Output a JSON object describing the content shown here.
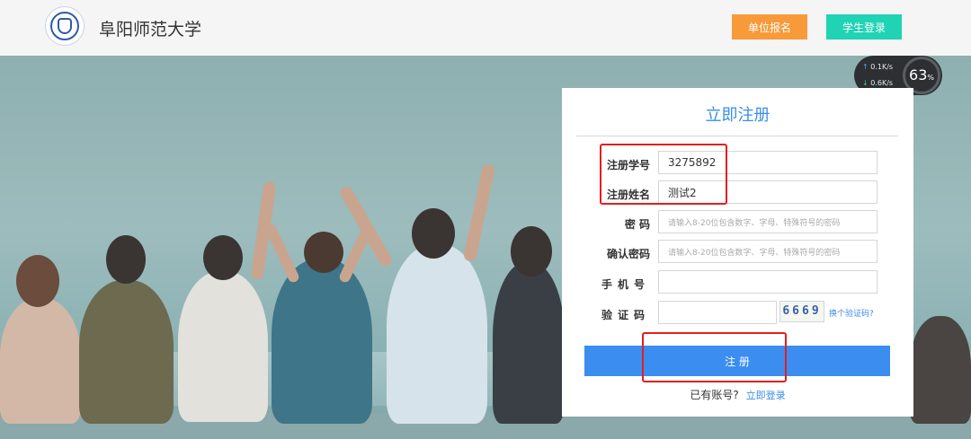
{
  "header": {
    "school_name": "阜阳师范大学",
    "unit_signup_label": "单位报名",
    "student_login_label": "学生登录"
  },
  "speed_widget": {
    "upload": "0.1",
    "upload_unit": "K/s",
    "download": "0.6",
    "download_unit": "K/s",
    "percent": "63",
    "percent_unit": "%"
  },
  "form": {
    "title": "立即注册",
    "fields": [
      {
        "label": "注册学号",
        "value": "3275892",
        "placeholder": ""
      },
      {
        "label": "注册姓名",
        "value": "测试2",
        "placeholder": ""
      },
      {
        "label": "密 码",
        "value": "",
        "placeholder": "请输入8-20位包含数字、字母、特殊符号的密码"
      },
      {
        "label": "确认密码",
        "value": "",
        "placeholder": "请输入8-20位包含数字、字母、特殊符号的密码"
      },
      {
        "label": "手机号",
        "value": "",
        "placeholder": ""
      },
      {
        "label": "验证码",
        "value": "",
        "placeholder": ""
      }
    ],
    "captcha_code": "6669",
    "change_captcha": "换个验证码?",
    "submit_label": "注 册",
    "login_prompt": "已有账号?",
    "login_link": "立即登录"
  },
  "colors": {
    "accent": "#3b8de8",
    "unit_button": "#f89a3a",
    "student_button": "#1fd3b4",
    "annotation": "#e31e1e"
  }
}
